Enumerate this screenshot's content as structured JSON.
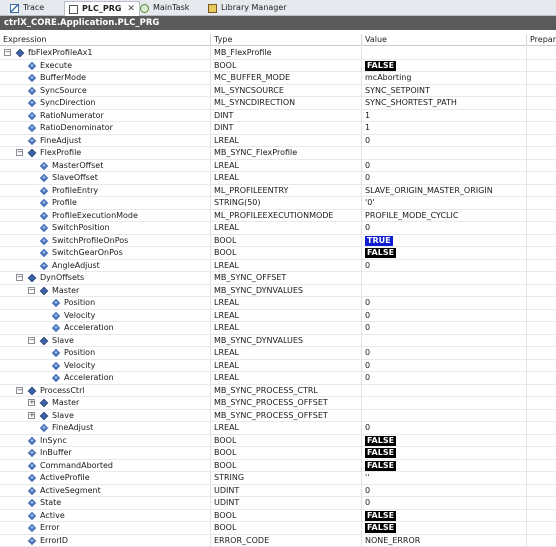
{
  "tabs": [
    {
      "label": "Trace",
      "icon": "trace-icon",
      "active": false
    },
    {
      "label": "PLC_PRG",
      "icon": "program-icon",
      "active": true
    },
    {
      "label": "MainTask",
      "icon": "task-icon",
      "active": false
    },
    {
      "label": "Library Manager",
      "icon": "library-icon",
      "active": false
    }
  ],
  "title": "ctrlX_CORE.Application.PLC_PRG",
  "columns": [
    "Expression",
    "Type",
    "Value",
    "Prepare"
  ],
  "rows": [
    {
      "name": "fbFlexProfileAx1",
      "type": "MB_FlexProfile",
      "value": "",
      "depth": 0,
      "toggle": "minus",
      "kind": "fb"
    },
    {
      "name": "Execute",
      "type": "BOOL",
      "value": "FALSE",
      "depth": 1,
      "toggle": "",
      "kind": "var",
      "badge": "false"
    },
    {
      "name": "BufferMode",
      "type": "MC_BUFFER_MODE",
      "value": "mcAborting",
      "depth": 1,
      "toggle": "",
      "kind": "var"
    },
    {
      "name": "SyncSource",
      "type": "ML_SYNCSOURCE",
      "value": "SYNC_SETPOINT",
      "depth": 1,
      "toggle": "",
      "kind": "var"
    },
    {
      "name": "SyncDirection",
      "type": "ML_SYNCDIRECTION",
      "value": "SYNC_SHORTEST_PATH",
      "depth": 1,
      "toggle": "",
      "kind": "var"
    },
    {
      "name": "RatioNumerator",
      "type": "DINT",
      "value": "1",
      "depth": 1,
      "toggle": "",
      "kind": "var"
    },
    {
      "name": "RatioDenominator",
      "type": "DINT",
      "value": "1",
      "depth": 1,
      "toggle": "",
      "kind": "var"
    },
    {
      "name": "FineAdjust",
      "type": "LREAL",
      "value": "0",
      "depth": 1,
      "toggle": "",
      "kind": "var"
    },
    {
      "name": "FlexProfile",
      "type": "MB_SYNC_FlexProfile",
      "value": "",
      "depth": 1,
      "toggle": "minus",
      "kind": "fb"
    },
    {
      "name": "MasterOffset",
      "type": "LREAL",
      "value": "0",
      "depth": 2,
      "toggle": "",
      "kind": "var"
    },
    {
      "name": "SlaveOffset",
      "type": "LREAL",
      "value": "0",
      "depth": 2,
      "toggle": "",
      "kind": "var"
    },
    {
      "name": "ProfileEntry",
      "type": "ML_PROFILEENTRY",
      "value": "SLAVE_ORIGIN_MASTER_ORIGIN",
      "depth": 2,
      "toggle": "",
      "kind": "var"
    },
    {
      "name": "Profile",
      "type": "STRING(50)",
      "value": "'0'",
      "depth": 2,
      "toggle": "",
      "kind": "var"
    },
    {
      "name": "ProfileExecutionMode",
      "type": "ML_PROFILEEXECUTIONMODE",
      "value": "PROFILE_MODE_CYCLIC",
      "depth": 2,
      "toggle": "",
      "kind": "var"
    },
    {
      "name": "SwitchPosition",
      "type": "LREAL",
      "value": "0",
      "depth": 2,
      "toggle": "",
      "kind": "var"
    },
    {
      "name": "SwitchProfileOnPos",
      "type": "BOOL",
      "value": "TRUE",
      "depth": 2,
      "toggle": "",
      "kind": "var",
      "badge": "true"
    },
    {
      "name": "SwitchGearOnPos",
      "type": "BOOL",
      "value": "FALSE",
      "depth": 2,
      "toggle": "",
      "kind": "var",
      "badge": "false"
    },
    {
      "name": "AngleAdjust",
      "type": "LREAL",
      "value": "0",
      "depth": 2,
      "toggle": "",
      "kind": "var"
    },
    {
      "name": "DynOffsets",
      "type": "MB_SYNC_OFFSET",
      "value": "",
      "depth": 1,
      "toggle": "minus",
      "kind": "fb"
    },
    {
      "name": "Master",
      "type": "MB_SYNC_DYNVALUES",
      "value": "",
      "depth": 2,
      "toggle": "minus",
      "kind": "fb"
    },
    {
      "name": "Position",
      "type": "LREAL",
      "value": "0",
      "depth": 3,
      "toggle": "",
      "kind": "var"
    },
    {
      "name": "Velocity",
      "type": "LREAL",
      "value": "0",
      "depth": 3,
      "toggle": "",
      "kind": "var"
    },
    {
      "name": "Acceleration",
      "type": "LREAL",
      "value": "0",
      "depth": 3,
      "toggle": "",
      "kind": "var"
    },
    {
      "name": "Slave",
      "type": "MB_SYNC_DYNVALUES",
      "value": "",
      "depth": 2,
      "toggle": "minus",
      "kind": "fb"
    },
    {
      "name": "Position",
      "type": "LREAL",
      "value": "0",
      "depth": 3,
      "toggle": "",
      "kind": "var"
    },
    {
      "name": "Velocity",
      "type": "LREAL",
      "value": "0",
      "depth": 3,
      "toggle": "",
      "kind": "var"
    },
    {
      "name": "Acceleration",
      "type": "LREAL",
      "value": "0",
      "depth": 3,
      "toggle": "",
      "kind": "var"
    },
    {
      "name": "ProcessCtrl",
      "type": "MB_SYNC_PROCESS_CTRL",
      "value": "",
      "depth": 1,
      "toggle": "minus",
      "kind": "fb"
    },
    {
      "name": "Master",
      "type": "MB_SYNC_PROCESS_OFFSET",
      "value": "",
      "depth": 2,
      "toggle": "plus",
      "kind": "fb"
    },
    {
      "name": "Slave",
      "type": "MB_SYNC_PROCESS_OFFSET",
      "value": "",
      "depth": 2,
      "toggle": "plus",
      "kind": "fb"
    },
    {
      "name": "FineAdjust",
      "type": "LREAL",
      "value": "0",
      "depth": 2,
      "toggle": "",
      "kind": "var"
    },
    {
      "name": "InSync",
      "type": "BOOL",
      "value": "FALSE",
      "depth": 1,
      "toggle": "",
      "kind": "var",
      "badge": "false"
    },
    {
      "name": "InBuffer",
      "type": "BOOL",
      "value": "FALSE",
      "depth": 1,
      "toggle": "",
      "kind": "var",
      "badge": "false"
    },
    {
      "name": "CommandAborted",
      "type": "BOOL",
      "value": "FALSE",
      "depth": 1,
      "toggle": "",
      "kind": "var",
      "badge": "false"
    },
    {
      "name": "ActiveProfile",
      "type": "STRING",
      "value": "''",
      "depth": 1,
      "toggle": "",
      "kind": "var"
    },
    {
      "name": "ActiveSegment",
      "type": "UDINT",
      "value": "0",
      "depth": 1,
      "toggle": "",
      "kind": "var"
    },
    {
      "name": "State",
      "type": "UDINT",
      "value": "0",
      "depth": 1,
      "toggle": "",
      "kind": "var"
    },
    {
      "name": "Active",
      "type": "BOOL",
      "value": "FALSE",
      "depth": 1,
      "toggle": "",
      "kind": "var",
      "badge": "false"
    },
    {
      "name": "Error",
      "type": "BOOL",
      "value": "FALSE",
      "depth": 1,
      "toggle": "",
      "kind": "var",
      "badge": "false"
    },
    {
      "name": "ErrorID",
      "type": "ERROR_CODE",
      "value": "NONE_ERROR",
      "depth": 1,
      "toggle": "",
      "kind": "var"
    }
  ]
}
